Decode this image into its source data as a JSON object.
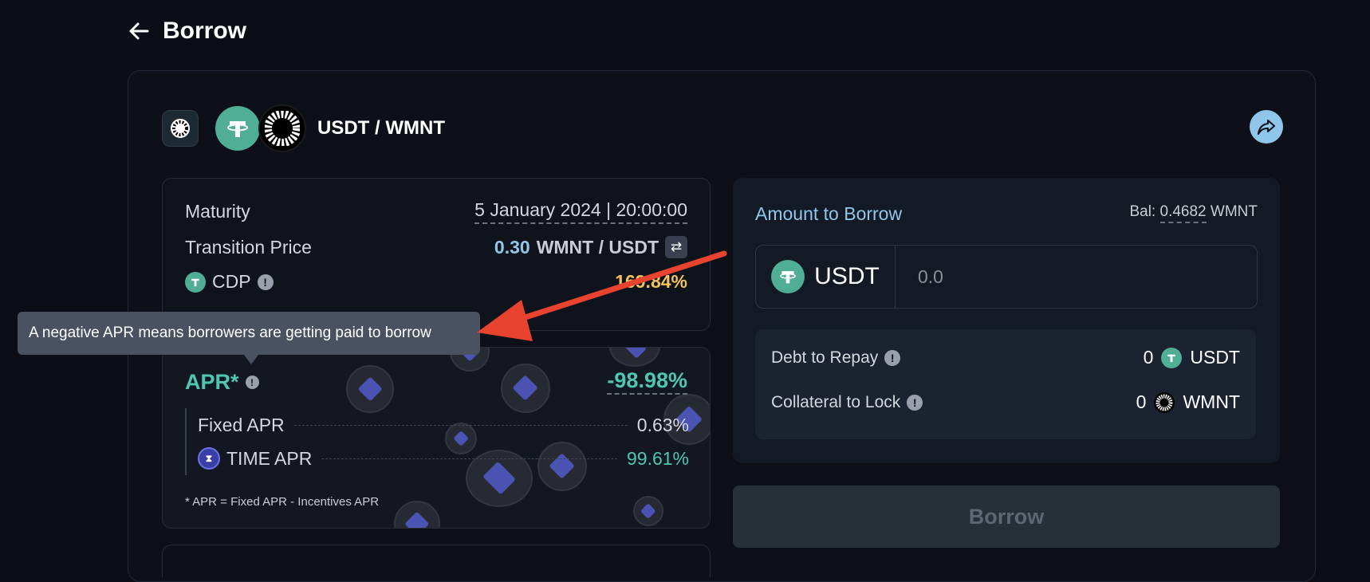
{
  "header": {
    "title": "Borrow"
  },
  "pair": {
    "label": "USDT / WMNT"
  },
  "info": {
    "maturity_label": "Maturity",
    "maturity_value": "5 January 2024 | 20:00:00",
    "transition_label": "Transition Price",
    "transition_value": "0.30",
    "transition_unit": "WMNT / USDT",
    "cdp_label": "CDP",
    "cdp_value": "169.84%"
  },
  "apr": {
    "title": "APR*",
    "value": "-98.98%",
    "fixed_label": "Fixed APR",
    "fixed_value": "0.63%",
    "time_label": "TIME APR",
    "time_value": "99.61%",
    "note": "* APR = Fixed APR - Incentives APR"
  },
  "tooltip": {
    "text": "A negative APR means borrowers are getting paid to borrow"
  },
  "borrow_panel": {
    "amount_label": "Amount to Borrow",
    "bal_label": "Bal:",
    "bal_value": "0.4682",
    "bal_unit": "WMNT",
    "token": "USDT",
    "input_placeholder": "0.0",
    "debt_label": "Debt to Repay",
    "debt_value": "0",
    "debt_token": "USDT",
    "collateral_label": "Collateral to Lock",
    "collateral_value": "0",
    "collateral_token": "WMNT"
  },
  "action": {
    "borrow_label": "Borrow"
  },
  "colors": {
    "accent": "#8fc7ea",
    "green": "#4fc7b0",
    "cdp": "#f3c260",
    "annotation_arrow": "#e8432e"
  }
}
